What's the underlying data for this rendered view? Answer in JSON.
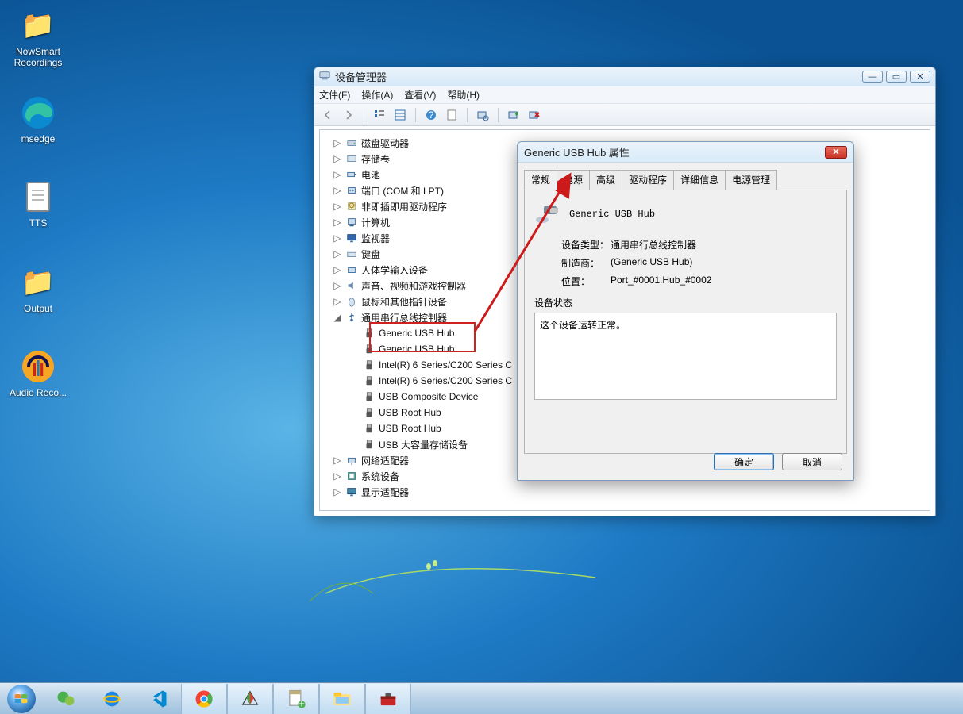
{
  "desktop": {
    "icons": [
      {
        "label": "NowSmart Recordings"
      },
      {
        "label": "msedge"
      },
      {
        "label": "TTS"
      },
      {
        "label": "Output"
      },
      {
        "label": "Audio Reco..."
      }
    ]
  },
  "device_manager": {
    "title": "设备管理器",
    "menus": [
      "文件(F)",
      "操作(A)",
      "查看(V)",
      "帮助(H)"
    ],
    "tree": [
      {
        "level": 1,
        "exp": "▷",
        "icon": "disk",
        "label": "磁盘驱动器"
      },
      {
        "level": 1,
        "exp": "▷",
        "icon": "volume",
        "label": "存储卷"
      },
      {
        "level": 1,
        "exp": "▷",
        "icon": "battery",
        "label": "电池"
      },
      {
        "level": 1,
        "exp": "▷",
        "icon": "port",
        "label": "端口 (COM 和 LPT)"
      },
      {
        "level": 1,
        "exp": "▷",
        "icon": "pnp",
        "label": "非即插即用驱动程序"
      },
      {
        "level": 1,
        "exp": "▷",
        "icon": "pc",
        "label": "计算机"
      },
      {
        "level": 1,
        "exp": "▷",
        "icon": "monitor",
        "label": "监视器"
      },
      {
        "level": 1,
        "exp": "▷",
        "icon": "keyboard",
        "label": "键盘"
      },
      {
        "level": 1,
        "exp": "▷",
        "icon": "hid",
        "label": "人体学输入设备"
      },
      {
        "level": 1,
        "exp": "▷",
        "icon": "audio",
        "label": "声音、视频和游戏控制器"
      },
      {
        "level": 1,
        "exp": "▷",
        "icon": "mouse",
        "label": "鼠标和其他指针设备"
      },
      {
        "level": 1,
        "exp": "◢",
        "icon": "usb",
        "label": "通用串行总线控制器"
      },
      {
        "level": 2,
        "exp": "",
        "icon": "usbdev",
        "label": "Generic USB Hub"
      },
      {
        "level": 2,
        "exp": "",
        "icon": "usbdev",
        "label": "Generic USB Hub"
      },
      {
        "level": 2,
        "exp": "",
        "icon": "usbdev",
        "label": "Intel(R) 6 Series/C200 Series C"
      },
      {
        "level": 2,
        "exp": "",
        "icon": "usbdev",
        "label": "Intel(R) 6 Series/C200 Series C"
      },
      {
        "level": 2,
        "exp": "",
        "icon": "usbdev",
        "label": "USB Composite Device"
      },
      {
        "level": 2,
        "exp": "",
        "icon": "usbdev",
        "label": "USB Root Hub"
      },
      {
        "level": 2,
        "exp": "",
        "icon": "usbdev",
        "label": "USB Root Hub"
      },
      {
        "level": 2,
        "exp": "",
        "icon": "usbdev",
        "label": "USB 大容量存储设备"
      },
      {
        "level": 1,
        "exp": "▷",
        "icon": "net",
        "label": "网络适配器"
      },
      {
        "level": 1,
        "exp": "▷",
        "icon": "system",
        "label": "系统设备"
      },
      {
        "level": 1,
        "exp": "▷",
        "icon": "display",
        "label": "显示适配器"
      }
    ]
  },
  "properties": {
    "title": "Generic USB Hub 属性",
    "tabs": [
      "常规",
      "电源",
      "高级",
      "驱动程序",
      "详细信息",
      "电源管理"
    ],
    "active_tab": 0,
    "device_name": "Generic USB Hub",
    "rows": [
      {
        "k": "设备类型：",
        "v": "通用串行总线控制器"
      },
      {
        "k": "制造商：",
        "v": "(Generic USB Hub)"
      },
      {
        "k": "位置：",
        "v": "Port_#0001.Hub_#0002"
      }
    ],
    "status_label": "设备状态",
    "status_text": "这个设备运转正常。",
    "ok": "确定",
    "cancel": "取消"
  },
  "taskbar": {
    "apps": [
      "wechat",
      "ie",
      "vscode",
      "chrome",
      "pyramid",
      "notepad",
      "explorer",
      "toolbox"
    ]
  }
}
